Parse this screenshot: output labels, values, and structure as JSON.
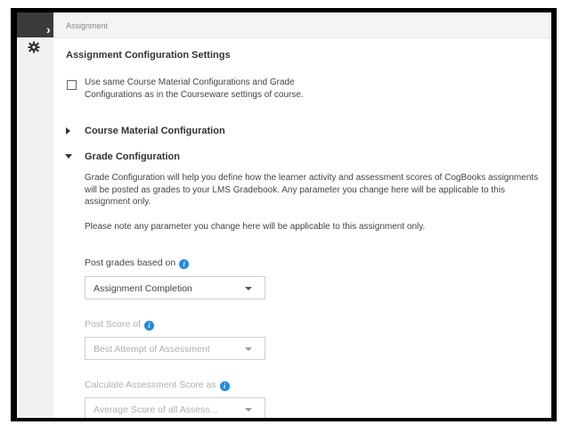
{
  "header": {
    "breadcrumb": "Assignment"
  },
  "settings": {
    "title": "Assignment Configuration Settings",
    "same_config_checkbox": {
      "label": "Use same Course Material Configurations and Grade Configurations as in the Courseware settings of course.",
      "checked": false
    },
    "course_material": {
      "title": "Course Material Configuration",
      "expanded": false
    },
    "grade_config": {
      "title": "Grade Configuration",
      "expanded": true,
      "description": "Grade Configuration will help you define how the learner activity and assessment scores of CogBooks assignments will be posted as grades to your LMS Gradebook. Any parameter you change here will be applicable to this assignment only.",
      "note": "Please note any parameter you change here will be applicable to this assignment only.",
      "post_grades": {
        "label": "Post grades based on",
        "value": "Assignment Completion",
        "enabled": true
      },
      "post_score": {
        "label": "Post Score of",
        "value": "Best Attempt of Assessment",
        "enabled": false
      },
      "calc_score": {
        "label": "Calculate Assessment Score as",
        "value": "Average Score of all Assess...",
        "enabled": false
      }
    }
  },
  "icons": {
    "info": "i",
    "rail_top": "chevron-right-icon",
    "rail_settings": "gear-icon"
  },
  "colors": {
    "info_blue": "#1f8ae0",
    "disabled_text": "#b0b0b0"
  }
}
